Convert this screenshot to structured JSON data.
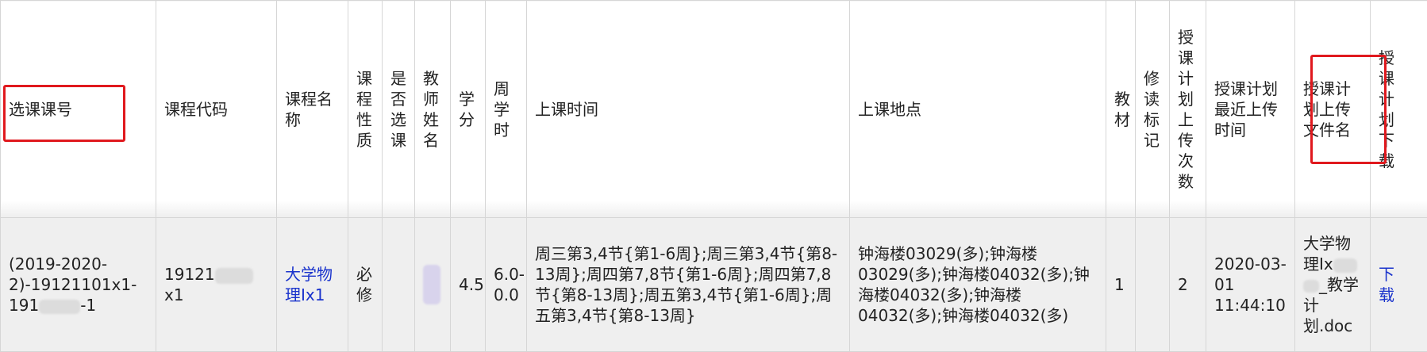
{
  "headers": {
    "col1": "选课课号",
    "col2": "课程代码",
    "col3": "课程名\n称",
    "col4": "课\n程\n性\n质",
    "col5": "是\n否\n选\n课",
    "col6": "教\n师\n姓\n名",
    "col7": "学\n分",
    "col8": "周学\n时",
    "col9": "上课时间",
    "col10": "上课地点",
    "col11": "教\n材",
    "col12": "修\n读\n标\n记",
    "col13": "授\n课\n计\n划\n上\n传\n次\n数",
    "col14": "授课计划\n最近上传\n时间",
    "col15": "授课计\n划上传\n文件名",
    "col16": "授\n课\n计\n划\n下\n载"
  },
  "row": {
    "selection_id_line1": "(2019-2020-",
    "selection_id_line2": "2)-19121101x1-",
    "selection_id_line3_a": "191",
    "selection_id_line3_b": "-1",
    "course_code_a": "19121",
    "course_code_b": "x1",
    "course_name": "大学物\n理Ix1",
    "course_type": "必\n修",
    "is_selected": "",
    "credits": "4.5",
    "weekly_hours": "6.0-\n0.0",
    "class_time": "周三第3,4节{第1-6周};周三第3,4节{第8-13周};周四第7,8节{第1-6周};周四第7,8节{第8-13周};周五第3,4节{第1-6周};周五第3,4节{第8-13周}",
    "location": "钟海楼03029(多);钟海楼03029(多);钟海楼04032(多);钟海楼04032(多);钟海楼04032(多);钟海楼04032(多)",
    "textbook": "1",
    "study_mark": "",
    "upload_count": "2",
    "last_upload_time": "2020-03-\n01\n11:44:10",
    "file_name_line1": "大学物",
    "file_name_line2": "理Ix",
    "file_name_line3": "_教学",
    "file_name_line4": "计",
    "file_name_line5": "划.doc",
    "download_label": "下\n载"
  },
  "colors": {
    "highlight": "#e0191e",
    "link": "#1a33cc",
    "row_bg": "#efefef"
  }
}
